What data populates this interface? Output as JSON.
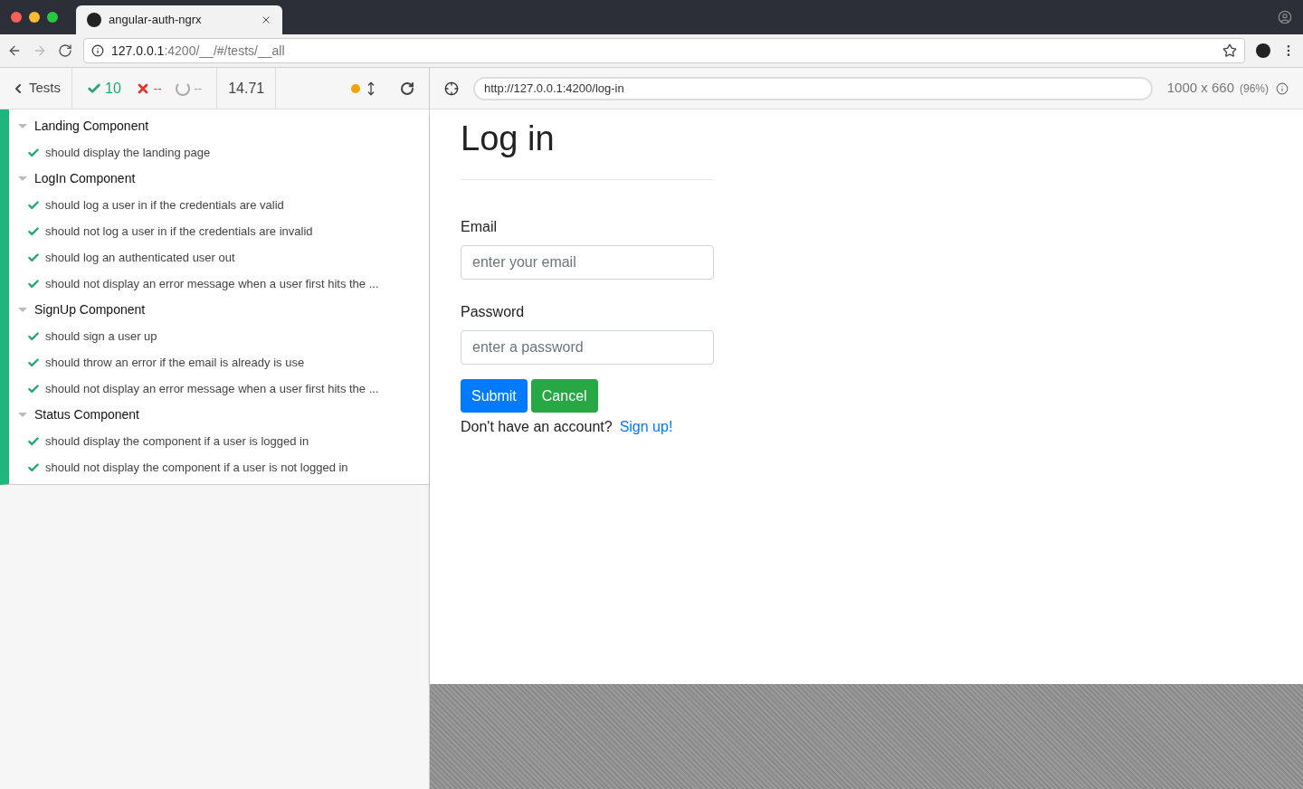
{
  "browser": {
    "tab_title": "angular-auth-ngrx",
    "url_host": "127.0.0.1",
    "url_rest": ":4200/__/#/tests/__all"
  },
  "runner": {
    "back_label": "Tests",
    "passed": "10",
    "failed": "--",
    "pending": "--",
    "duration": "14.71",
    "app_url": "http://127.0.0.1:4200/log-in",
    "viewport": "1000 x 660",
    "scale": "(96%)"
  },
  "suites": [
    {
      "title": "Landing Component",
      "expanded": true,
      "tests": [
        {
          "title": "should display the landing page",
          "passed": true
        }
      ]
    },
    {
      "title": "LogIn Component",
      "expanded": true,
      "tests": [
        {
          "title": "should log a user in if the credentials are valid",
          "passed": true
        },
        {
          "title": "should not log a user in if the credentials are invalid",
          "passed": true
        },
        {
          "title": "should log an authenticated user out",
          "passed": true
        },
        {
          "title": "should not display an error message when a user first hits the ...",
          "passed": true
        }
      ]
    },
    {
      "title": "SignUp Component",
      "expanded": true,
      "tests": [
        {
          "title": "should sign a user up",
          "passed": true
        },
        {
          "title": "should throw an error if the email is already is use",
          "passed": true
        },
        {
          "title": "should not display an error message when a user first hits the ...",
          "passed": true
        }
      ]
    },
    {
      "title": "Status Component",
      "expanded": true,
      "tests": [
        {
          "title": "should display the component if a user is logged in",
          "passed": true
        },
        {
          "title": "should not display the component if a user is not logged in",
          "passed": true
        }
      ]
    }
  ],
  "app": {
    "heading": "Log in",
    "fields": [
      {
        "label": "Email",
        "placeholder": "enter your email"
      },
      {
        "label": "Password",
        "placeholder": "enter a password"
      }
    ],
    "buttons": [
      {
        "label": "Submit",
        "kind": "primary"
      },
      {
        "label": "Cancel",
        "kind": "success"
      }
    ],
    "signup_prompt": "Don't have an account?",
    "signup_link": "Sign up!"
  }
}
